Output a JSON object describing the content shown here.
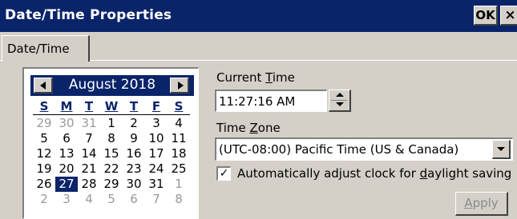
{
  "window": {
    "title": "Date/Time Properties",
    "ok_label": "OK",
    "close_label": "×"
  },
  "tabs": [
    {
      "label": "Date/Time",
      "selected": true
    }
  ],
  "calendar": {
    "month_label": "August 2018",
    "weekdays": [
      "S",
      "M",
      "T",
      "W",
      "T",
      "F",
      "S"
    ],
    "weeks": [
      [
        {
          "d": "29",
          "cur": false
        },
        {
          "d": "30",
          "cur": false
        },
        {
          "d": "31",
          "cur": false
        },
        {
          "d": "1",
          "cur": true
        },
        {
          "d": "2",
          "cur": true
        },
        {
          "d": "3",
          "cur": true
        },
        {
          "d": "4",
          "cur": true
        }
      ],
      [
        {
          "d": "5",
          "cur": true
        },
        {
          "d": "6",
          "cur": true
        },
        {
          "d": "7",
          "cur": true
        },
        {
          "d": "8",
          "cur": true
        },
        {
          "d": "9",
          "cur": true
        },
        {
          "d": "10",
          "cur": true
        },
        {
          "d": "11",
          "cur": true
        }
      ],
      [
        {
          "d": "12",
          "cur": true
        },
        {
          "d": "13",
          "cur": true
        },
        {
          "d": "14",
          "cur": true
        },
        {
          "d": "15",
          "cur": true
        },
        {
          "d": "16",
          "cur": true
        },
        {
          "d": "17",
          "cur": true
        },
        {
          "d": "18",
          "cur": true
        }
      ],
      [
        {
          "d": "19",
          "cur": true
        },
        {
          "d": "20",
          "cur": true
        },
        {
          "d": "21",
          "cur": true
        },
        {
          "d": "22",
          "cur": true
        },
        {
          "d": "23",
          "cur": true
        },
        {
          "d": "24",
          "cur": true
        },
        {
          "d": "25",
          "cur": true
        }
      ],
      [
        {
          "d": "26",
          "cur": true
        },
        {
          "d": "27",
          "cur": true,
          "selected": true
        },
        {
          "d": "28",
          "cur": true
        },
        {
          "d": "29",
          "cur": true
        },
        {
          "d": "30",
          "cur": true
        },
        {
          "d": "31",
          "cur": true
        },
        {
          "d": "1",
          "cur": false
        }
      ],
      [
        {
          "d": "2",
          "cur": false
        },
        {
          "d": "3",
          "cur": false
        },
        {
          "d": "4",
          "cur": false
        },
        {
          "d": "5",
          "cur": false
        },
        {
          "d": "6",
          "cur": false
        },
        {
          "d": "7",
          "cur": false
        },
        {
          "d": "8",
          "cur": false
        }
      ]
    ]
  },
  "current_time": {
    "label_pre": "Current ",
    "label_key": "T",
    "label_post": "ime",
    "value": "11:27:16 AM"
  },
  "time_zone": {
    "label_pre": "Time ",
    "label_key": "Z",
    "label_post": "one",
    "selected": "(UTC-08:00) Pacific Time (US & Canada)"
  },
  "dst": {
    "checked": true,
    "check_glyph": "✓",
    "label_pre": "Automatically adjust clock for ",
    "label_key": "d",
    "label_post": "aylight saving"
  },
  "apply": {
    "key": "A",
    "rest": "pply",
    "enabled": false
  },
  "colors": {
    "titlebar": "#0a246a",
    "face": "#d4d0c8",
    "selection": "#0a246a",
    "disabled_text": "#8a8a8a"
  }
}
